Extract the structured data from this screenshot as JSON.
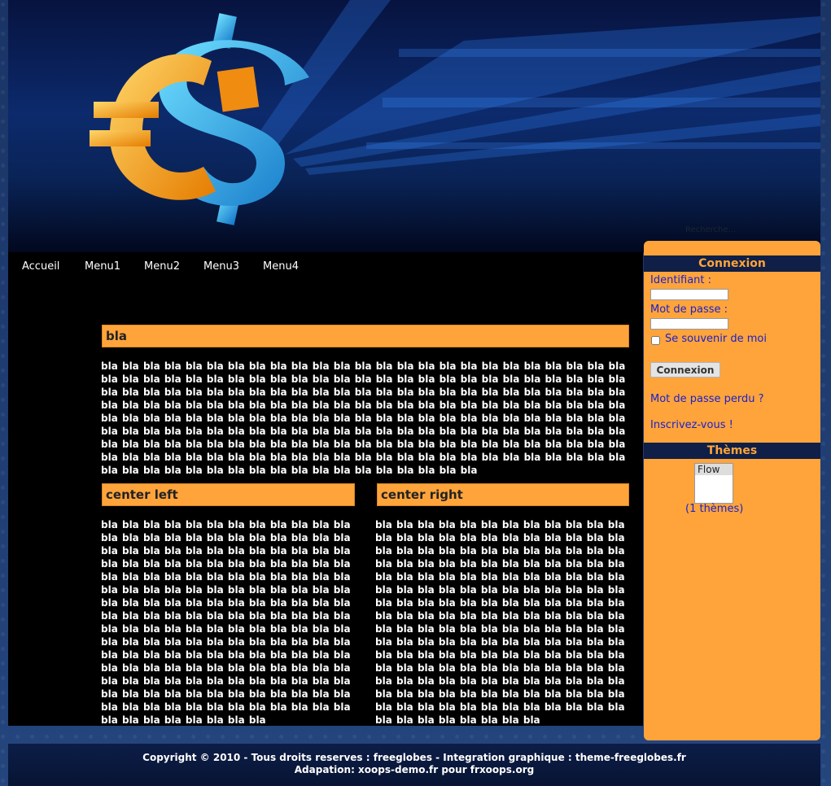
{
  "search": {
    "placeholder": "Recherche..."
  },
  "nav": {
    "items": [
      "Accueil",
      "Menu1",
      "Menu2",
      "Menu3",
      "Menu4"
    ]
  },
  "main_block": {
    "title": "bla"
  },
  "left_block": {
    "title": "center left"
  },
  "right_block": {
    "title": "center right"
  },
  "sidebar": {
    "login_title": "Connexion",
    "username_label": "Identifiant :",
    "password_label": "Mot de passe :",
    "remember_label": "Se souvenir de moi",
    "login_button": "Connexion",
    "lost_password": "Mot de passe perdu ?",
    "register": "Inscrivez-vous !",
    "themes_title": "Thèmes",
    "theme_selected": "Flow",
    "theme_count": "(1 thèmes)"
  },
  "footer": {
    "line1": "Copyright © 2010 - Tous droits reserves : freeglobes - Integration graphique : theme-freeglobes.fr",
    "line2": "Adapation: xoops-demo.fr pour frxoops.org"
  },
  "colors": {
    "accent": "#ffa43b",
    "link": "#1a22cc",
    "dark": "#0f1f47"
  },
  "icons": {
    "banner_logo": "euro-dollar-icon"
  }
}
